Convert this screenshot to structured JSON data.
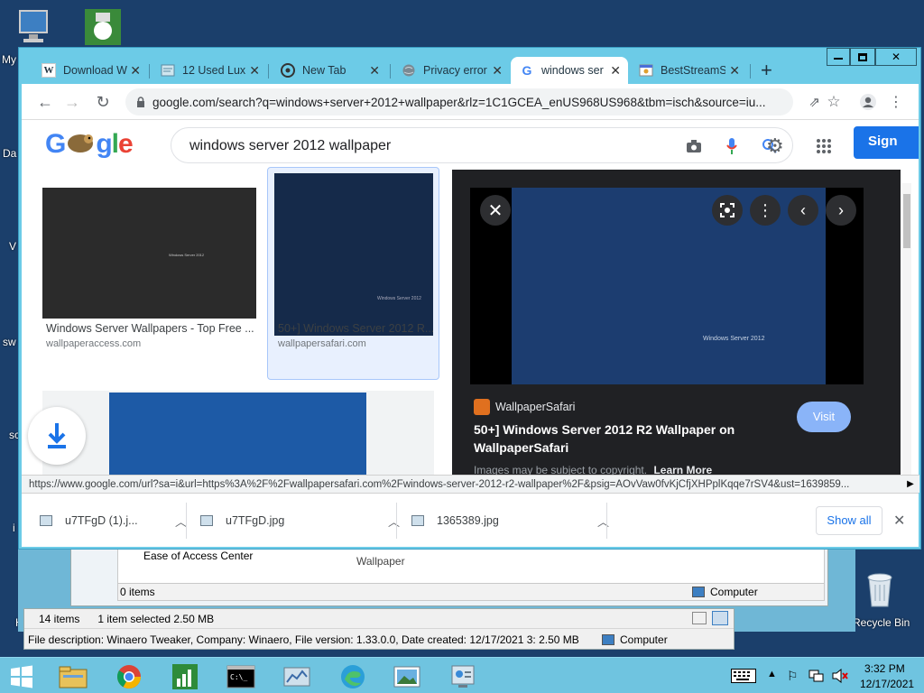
{
  "desktop": {
    "icons": [
      {
        "label": "My",
        "icon": "computer-icon"
      },
      {
        "label": "Da",
        "icon": "folder-icon"
      },
      {
        "label": "V",
        "icon": "app-icon"
      },
      {
        "label": "sw",
        "icon": "app-icon"
      },
      {
        "label": "sc",
        "icon": "app-icon"
      },
      {
        "label": "i",
        "icon": "app-icon"
      },
      {
        "label": "H",
        "icon": "app-icon"
      }
    ],
    "recycle_bin_label": "Recycle Bin"
  },
  "browser": {
    "tabs": [
      {
        "title": "Download W",
        "icon": "W"
      },
      {
        "title": "12 Used Lux",
        "icon": "page"
      },
      {
        "title": "New Tab",
        "icon": "chrome"
      },
      {
        "title": "Privacy error",
        "icon": "globe"
      },
      {
        "title": "windows ser",
        "icon": "G",
        "active": true
      },
      {
        "title": "BestStreamS",
        "icon": "site"
      }
    ],
    "new_tab_label": "+",
    "address": "google.com/search?q=windows+server+2012+wallpaper&rlz=1C1GCEA_enUS968US968&tbm=isch&source=iu..."
  },
  "google": {
    "logo": "Google",
    "query": "windows server 2012 wallpaper",
    "sign_in_label": "Sign",
    "results": [
      {
        "title": "Windows Server Wallpapers - Top Free ...",
        "source": "wallpaperaccess.com",
        "image_text": "Windows Server 2012"
      },
      {
        "title": "50+] Windows Server 2012 R...",
        "source": "wallpapersafari.com",
        "image_text": "Windows Server 2012"
      }
    ],
    "viewer": {
      "site_name": "WallpaperSafari",
      "title": "50+] Windows Server 2012 R2 Wallpaper on WallpaperSafari",
      "visit_label": "Visit",
      "image_text": "Windows Server 2012",
      "copyright_text": "Images may be subject to copyright.",
      "learn_more_label": "Learn More"
    }
  },
  "status_url": "https://www.google.com/url?sa=i&url=https%3A%2F%2Fwallpapersafari.com%2Fwindows-server-2012-r2-wallpaper%2F&psig=AOvVaw0fvKjCfjXHPplKqqe7rSV4&ust=1639859...",
  "downloads": {
    "items": [
      {
        "name": "u7TFgD (1).j..."
      },
      {
        "name": "u7TFgD.jpg"
      },
      {
        "name": "1365389.jpg"
      }
    ],
    "show_all_label": "Show all"
  },
  "explorer": {
    "ease_label": "Ease of Access Center",
    "wallpaper_label": "Wallpaper",
    "items_count": "0 items",
    "computer_label": "Computer",
    "items_14": "14 items",
    "selected": "1 item selected  2.50 MB",
    "file_description": "File description: Winaero Tweaker, Company: Winaero, File version: 1.33.0.0, Date created: 12/17/2021 3: 2.50 MB",
    "computer_label2": "Computer"
  },
  "taskbar": {
    "time": "3:32 PM",
    "date": "12/17/2021"
  },
  "colors": {
    "desktop": "#1b3f6b",
    "chrome_frame": "#6ccbe7",
    "google_blue": "#1a73e8",
    "visit_button": "#8ab4f8"
  }
}
